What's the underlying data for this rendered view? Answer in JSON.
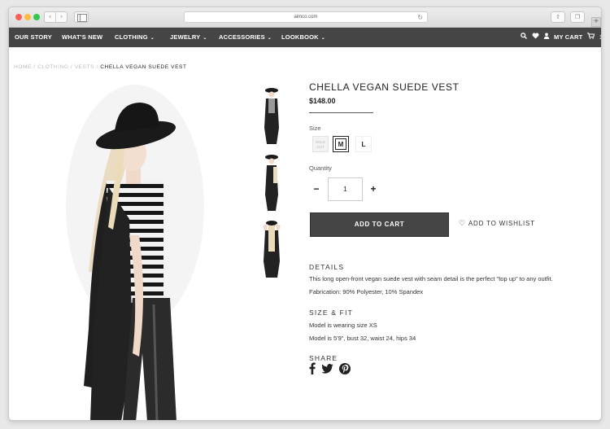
{
  "browser": {
    "url": "aimco.com",
    "colors": {
      "close": "#fc605b",
      "minimize": "#fdbc40",
      "zoom": "#34c84a"
    }
  },
  "nav": {
    "items": [
      {
        "label": "OUR STORY",
        "dropdown": false
      },
      {
        "label": "WHAT'S NEW",
        "dropdown": false
      },
      {
        "label": "CLOTHING",
        "dropdown": true
      },
      {
        "label": "JEWELRY",
        "dropdown": true
      },
      {
        "label": "ACCESSORIES",
        "dropdown": true
      },
      {
        "label": "LOOKBOOK",
        "dropdown": true
      }
    ],
    "cart_label": "MY CART",
    "cart_count": "1"
  },
  "breadcrumb": {
    "home": "HOME",
    "clothing": "CLOTHING",
    "vests": "VESTS",
    "sep": "/",
    "current": "CHELLA VEGAN SUEDE VEST"
  },
  "product": {
    "title": "CHELLA VEGAN SUEDE VEST",
    "price": "$148.00",
    "size_label": "Size",
    "sizes": {
      "sold_out": "SOLD OUT",
      "m": "M",
      "l": "L"
    },
    "quantity_label": "Quantity",
    "quantity": "1",
    "add_to_cart": "ADD TO CART",
    "add_to_wishlist": "ADD TO WISHLIST"
  },
  "details": {
    "heading": "DETAILS",
    "line1": "This long open-front vegan suede vest with seam detail is the perfect \"top up\" to any outfit.",
    "line2": "Fabrication: 90% Polyester, 10% Spandex"
  },
  "size_fit": {
    "heading": "SIZE & FIT",
    "line1": "Model is wearing size XS",
    "line2": "Model is 5'9\", bust 32, waist 24, hips 34"
  },
  "share": {
    "heading": "SHARE"
  }
}
